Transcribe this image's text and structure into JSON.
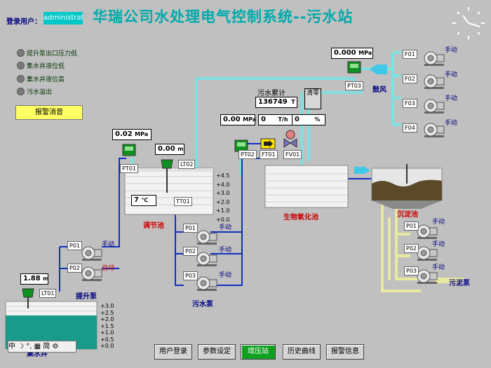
{
  "title": "华瑞公司水处理电气控制系统--污水站",
  "login": {
    "label": "登录用户：",
    "user": "administrato"
  },
  "alarms": [
    {
      "label": "提升泵出口压力低"
    },
    {
      "label": "集水井液位低"
    },
    {
      "label": "集水井液位高"
    },
    {
      "label": "污水溢出"
    }
  ],
  "mute_button": "报警消音",
  "readings": {
    "pt01": "0.02",
    "lt02": "0.00",
    "tt01": "7",
    "lt01": "1.88",
    "pt02": "0.00",
    "ft01": "0",
    "fv01": "0",
    "pt03": "0.000",
    "total": "136749"
  },
  "units": {
    "mpa": "MPa",
    "m": "m",
    "c": "℃",
    "th": "T/h",
    "pct": "%",
    "t": "T"
  },
  "total_label": "污水累计",
  "clear_button": "清零",
  "tags": {
    "pt01": "PT01",
    "lt02": "LT02",
    "tt01": "TT01",
    "lt01": "LT01",
    "pt02": "PT02",
    "ft01": "FT01",
    "fv01": "FV01",
    "pt03": "PT03"
  },
  "areas": {
    "regulating": "调节池",
    "bio": "生物氧化池",
    "settling": "沉淀池",
    "lift_pump": "提升泵",
    "sewage_pump": "污水泵",
    "sludge_pump": "污泥泵",
    "blower": "鼓风",
    "collect": "集水井"
  },
  "modes": {
    "manual": "手动",
    "auto": "自动"
  },
  "pumps": {
    "lift": [
      "P01",
      "P02"
    ],
    "sewage": [
      "P01",
      "P02",
      "P03"
    ],
    "sludge": [
      "P01",
      "P02",
      "P03"
    ],
    "fans": [
      "F01",
      "F02",
      "F03",
      "F04"
    ]
  },
  "scale_regulating": [
    "+4.5",
    "+4.0",
    "+3.0",
    "+2.0",
    "+1.0",
    "+0.0"
  ],
  "scale_collect": [
    "+3.0",
    "+2.5",
    "+2.0",
    "+1.5",
    "+1.0",
    "+0.5",
    "+0.0"
  ],
  "nav": [
    {
      "label": "用户登录",
      "active": false
    },
    {
      "label": "参数设定",
      "active": false
    },
    {
      "label": "增压站",
      "active": true
    },
    {
      "label": "历史曲线",
      "active": false
    },
    {
      "label": "报警信息",
      "active": false
    }
  ],
  "ime": {
    "text": "中 ☽ °, ▦ 简 ⚙"
  },
  "colors": {
    "pipe_water": "#1030c0",
    "pipe_air": "#80e0e0",
    "pipe_sludge": "#e8e8a0",
    "title": "#00aaaa",
    "active_button": "#10a020"
  }
}
